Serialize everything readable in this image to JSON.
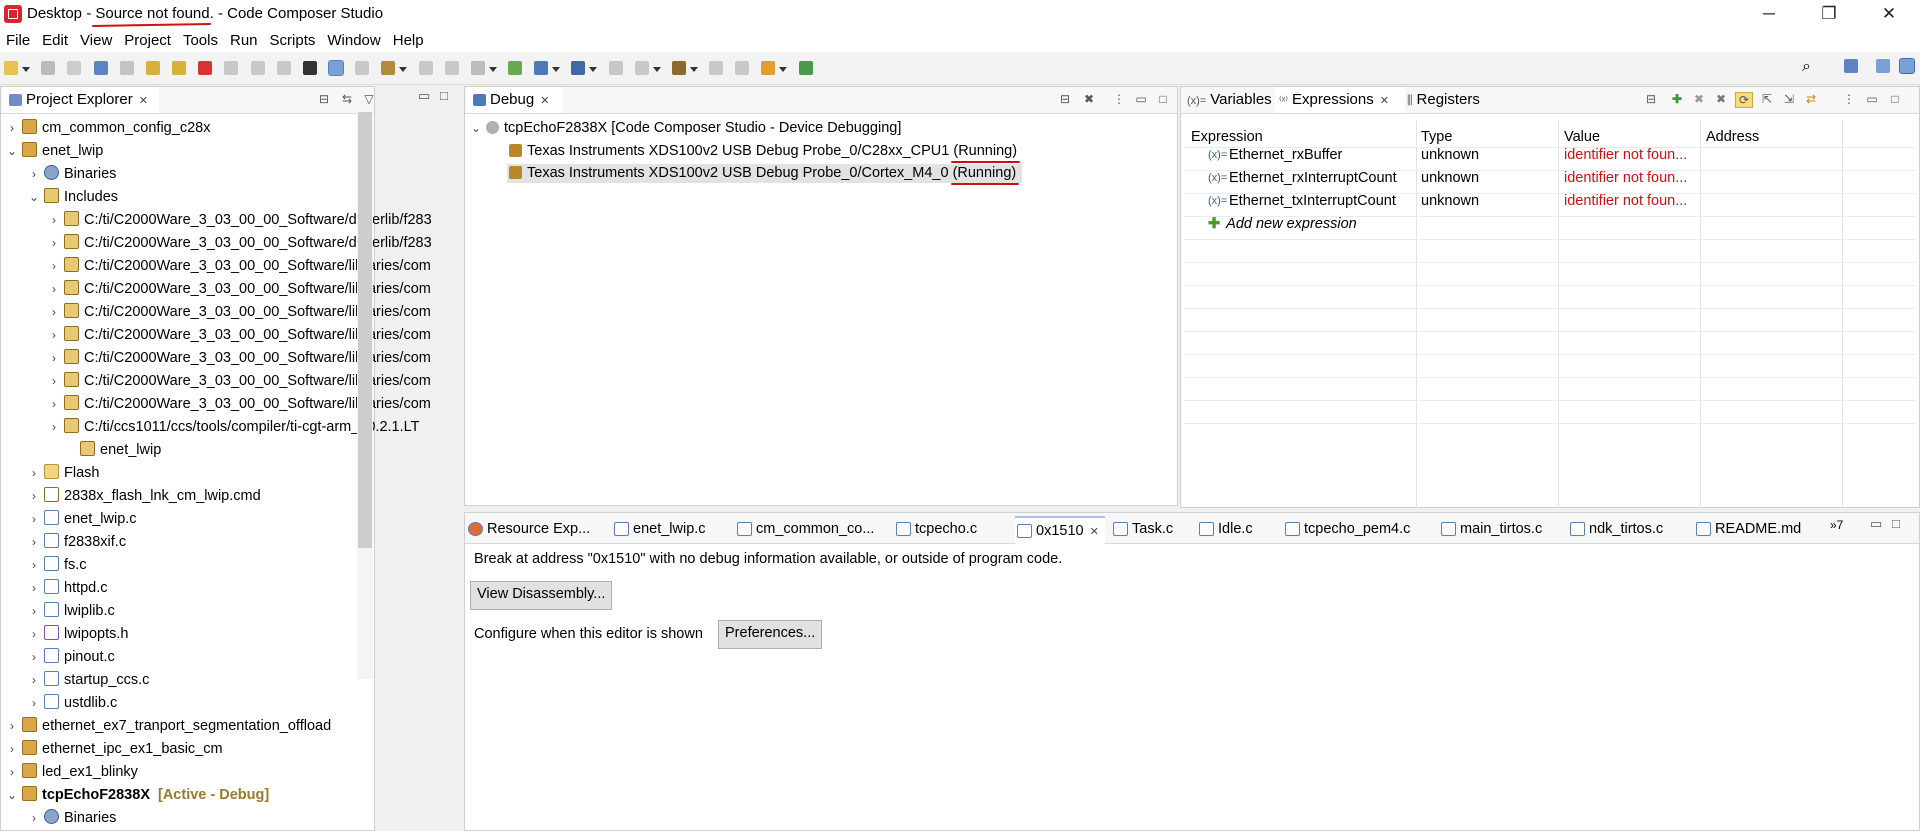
{
  "title": {
    "prefix": "Desktop - ",
    "source": "Source not found",
    "suffix": ". - Code Composer Studio"
  },
  "window_controls": {
    "minimize": "─",
    "restore": "❐",
    "close": "✕"
  },
  "menu": [
    "File",
    "Edit",
    "View",
    "Project",
    "Tools",
    "Run",
    "Scripts",
    "Window",
    "Help"
  ],
  "project_explorer": {
    "tab_label": "Project Explorer",
    "rows": [
      {
        "twisty": "›",
        "icon": "project-icon",
        "label": "cm_common_config_c28x"
      },
      {
        "twisty": "⌄",
        "icon": "project-icon",
        "label": "enet_lwip"
      },
      {
        "twisty": "›",
        "icon": "binaries-icon",
        "label": "Binaries"
      },
      {
        "twisty": "⌄",
        "icon": "includes-icon",
        "label": "Includes"
      },
      {
        "twisty": "›",
        "icon": "include-folder-icon",
        "label": "C:/ti/C2000Ware_3_03_00_00_Software/driverlib/f283"
      },
      {
        "twisty": "›",
        "icon": "include-folder-icon",
        "label": "C:/ti/C2000Ware_3_03_00_00_Software/driverlib/f283"
      },
      {
        "twisty": "›",
        "icon": "include-folder-icon",
        "label": "C:/ti/C2000Ware_3_03_00_00_Software/libraries/com"
      },
      {
        "twisty": "›",
        "icon": "include-folder-icon",
        "label": "C:/ti/C2000Ware_3_03_00_00_Software/libraries/com"
      },
      {
        "twisty": "›",
        "icon": "include-folder-icon",
        "label": "C:/ti/C2000Ware_3_03_00_00_Software/libraries/com"
      },
      {
        "twisty": "›",
        "icon": "include-folder-icon",
        "label": "C:/ti/C2000Ware_3_03_00_00_Software/libraries/com"
      },
      {
        "twisty": "›",
        "icon": "include-folder-icon",
        "label": "C:/ti/C2000Ware_3_03_00_00_Software/libraries/com"
      },
      {
        "twisty": "›",
        "icon": "include-folder-icon",
        "label": "C:/ti/C2000Ware_3_03_00_00_Software/libraries/com"
      },
      {
        "twisty": "›",
        "icon": "include-folder-icon",
        "label": "C:/ti/C2000Ware_3_03_00_00_Software/libraries/com"
      },
      {
        "twisty": "›",
        "icon": "include-folder-icon",
        "label": "C:/ti/ccs1011/ccs/tools/compiler/ti-cgt-arm_20.2.1.LT"
      },
      {
        "twisty": "",
        "icon": "include-folder-icon",
        "label": "enet_lwip"
      },
      {
        "twisty": "›",
        "icon": "folder-icon",
        "label": "Flash"
      },
      {
        "twisty": "›",
        "icon": "cmd-file-icon",
        "label": "2838x_flash_lnk_cm_lwip.cmd"
      },
      {
        "twisty": "›",
        "icon": "c-file-icon",
        "label": "enet_lwip.c"
      },
      {
        "twisty": "›",
        "icon": "c-file-icon",
        "label": "f2838xif.c"
      },
      {
        "twisty": "›",
        "icon": "c-file-icon",
        "label": "fs.c"
      },
      {
        "twisty": "›",
        "icon": "c-file-icon",
        "label": "httpd.c"
      },
      {
        "twisty": "›",
        "icon": "c-file-icon",
        "label": "lwiplib.c"
      },
      {
        "twisty": "›",
        "icon": "h-file-icon",
        "label": "lwipopts.h"
      },
      {
        "twisty": "›",
        "icon": "c-file-icon",
        "label": "pinout.c"
      },
      {
        "twisty": "›",
        "icon": "c-file-icon",
        "label": "startup_ccs.c"
      },
      {
        "twisty": "›",
        "icon": "c-file-icon",
        "label": "ustdlib.c"
      },
      {
        "twisty": "›",
        "icon": "project-icon",
        "label": "ethernet_ex7_tranport_segmentation_offload"
      },
      {
        "twisty": "›",
        "icon": "project-icon",
        "label": "ethernet_ipc_ex1_basic_cm"
      },
      {
        "twisty": "›",
        "icon": "project-icon",
        "label": "led_ex1_blinky"
      },
      {
        "twisty": "⌄",
        "icon": "project-icon",
        "label": "tcpEchoF2838X",
        "badge": "[Active - Debug]"
      },
      {
        "twisty": "›",
        "icon": "binaries-icon",
        "label": "Binaries"
      }
    ]
  },
  "debug": {
    "tab_label": "Debug",
    "session": "tcpEchoF2838X [Code Composer Studio - Device Debugging]",
    "targets": [
      {
        "label": "Texas Instruments XDS100v2 USB Debug Probe_0/C28xx_CPU1 ",
        "status": "(Running)"
      },
      {
        "label": "Texas Instruments XDS100v2 USB Debug Probe_0/Cortex_M4_0 ",
        "status": "(Running)"
      }
    ]
  },
  "right_tabs": {
    "variables": "Variables",
    "expressions": "Expressions",
    "registers": "Registers"
  },
  "expressions": {
    "columns": [
      "Expression",
      "Type",
      "Value",
      "Address"
    ],
    "rows": [
      {
        "name": "Ethernet_rxBuffer",
        "type": "unknown",
        "value": "identifier not foun...",
        "address": ""
      },
      {
        "name": "Ethernet_rxInterruptCount",
        "type": "unknown",
        "value": "identifier not foun...",
        "address": ""
      },
      {
        "name": "Ethernet_txInterruptCount",
        "type": "unknown",
        "value": "identifier not foun...",
        "address": ""
      }
    ],
    "add_new": "Add new expression"
  },
  "editor_tabs": [
    "Resource Exp...",
    "enet_lwip.c",
    "cm_common_co...",
    "tcpecho.c",
    "0x1510",
    "Task.c",
    "Idle.c",
    "tcpecho_pem4.c",
    "main_tirtos.c",
    "ndk_tirtos.c",
    "README.md"
  ],
  "editor_overflow": "»7",
  "editor": {
    "message": "Break at address \"0x1510\" with no debug information available, or outside of program code.",
    "view_disassembly": "View Disassembly...",
    "configure_text": "Configure when this editor is shown",
    "preferences": "Preferences..."
  }
}
